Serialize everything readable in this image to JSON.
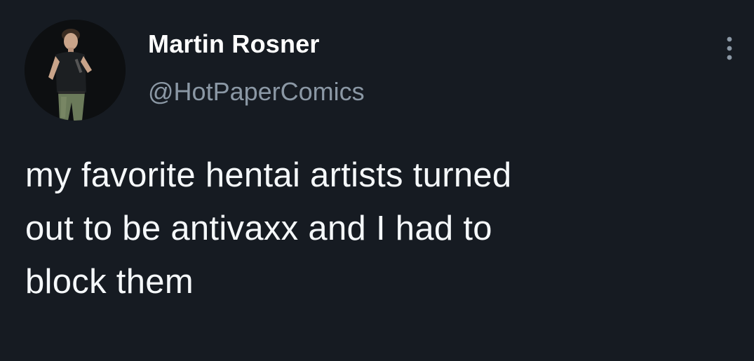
{
  "author": {
    "display_name": "Martin Rosner",
    "handle": "@HotPaperComics",
    "avatar_icon": "profile-photo-performer-with-microphone"
  },
  "tweet": {
    "text": "my favorite hentai artists turned\nout to be antivaxx and I had to\nblock them"
  },
  "actions": {
    "more_icon": "vertical-ellipsis-icon"
  },
  "colors": {
    "background": "#161b22",
    "primary_text": "#ffffff",
    "secondary_text": "#8b98a5"
  }
}
